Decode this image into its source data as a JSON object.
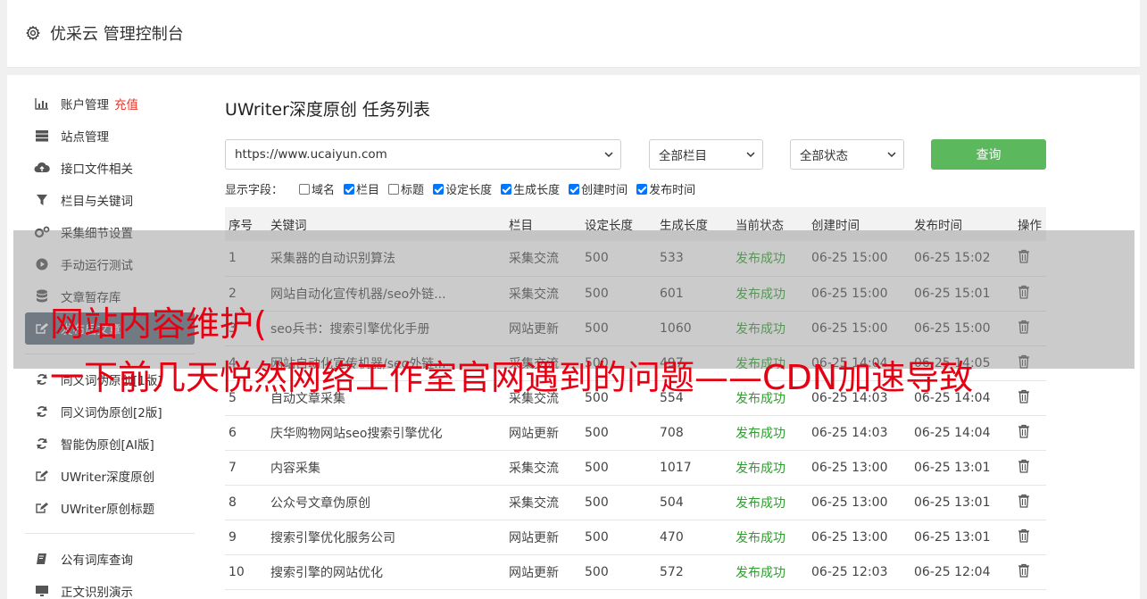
{
  "header": {
    "title": "优采云 管理控制台"
  },
  "sidebar": {
    "items": [
      {
        "label": "账户管理",
        "extra": "充值",
        "icon": "bar-chart-icon"
      },
      {
        "label": "站点管理",
        "icon": "server-icon"
      },
      {
        "label": "接口文件相关",
        "icon": "cloud-upload-icon"
      },
      {
        "label": "栏目与关键词",
        "icon": "filter-icon"
      },
      {
        "label": "采集细节设置",
        "icon": "gears-icon"
      },
      {
        "label": "手动运行测试",
        "icon": "play-circle-icon"
      },
      {
        "label": "文章暂存库",
        "icon": "database-icon"
      },
      {
        "label": "发布后文章",
        "icon": "edit-icon"
      },
      {
        "label": "同义词伪原创[1版]",
        "icon": "refresh-icon"
      },
      {
        "label": "同义词伪原创[2版]",
        "icon": "refresh-icon"
      },
      {
        "label": "智能伪原创[AI版]",
        "icon": "refresh-icon"
      },
      {
        "label": "UWriter深度原创",
        "icon": "edit-icon"
      },
      {
        "label": "UWriter原创标题",
        "icon": "edit-icon"
      },
      {
        "label": "公有词库查询",
        "icon": "book-icon"
      },
      {
        "label": "正文识别演示",
        "icon": "monitor-icon"
      }
    ]
  },
  "main": {
    "title": "UWriter深度原创 任务列表",
    "site_select": "https://www.ucaiyun.com",
    "column_select": "全部栏目",
    "status_select": "全部状态",
    "query_label": "查询",
    "fields_label": "显示字段：",
    "fields": [
      {
        "label": "域名",
        "checked": false
      },
      {
        "label": "栏目",
        "checked": true
      },
      {
        "label": "标题",
        "checked": false
      },
      {
        "label": "设定长度",
        "checked": true
      },
      {
        "label": "生成长度",
        "checked": true
      },
      {
        "label": "创建时间",
        "checked": true
      },
      {
        "label": "发布时间",
        "checked": true
      }
    ],
    "columns": [
      "序号",
      "关键词",
      "栏目",
      "设定长度",
      "生成长度",
      "当前状态",
      "创建时间",
      "发布时间",
      "操作"
    ],
    "rows": [
      [
        "1",
        "采集器的自动识别算法",
        "采集交流",
        "500",
        "533",
        "发布成功",
        "06-25 15:00",
        "06-25 15:02"
      ],
      [
        "2",
        "网站自动化宣传机器/seo外链...",
        "采集交流",
        "500",
        "601",
        "发布成功",
        "06-25 15:00",
        "06-25 15:01"
      ],
      [
        "3",
        "seo兵书：搜索引擎优化手册",
        "网站更新",
        "500",
        "1060",
        "发布成功",
        "06-25 15:00",
        "06-25 15:00"
      ],
      [
        "4",
        "网站自动化宣传机器/seo外链...",
        "采集交流",
        "500",
        "497",
        "发布成功",
        "06-25 14:04",
        "06-25 14:05"
      ],
      [
        "5",
        "自动文章采集",
        "采集交流",
        "500",
        "554",
        "发布成功",
        "06-25 14:03",
        "06-25 14:04"
      ],
      [
        "6",
        "庆华购物网站seo搜索引擎优化",
        "网站更新",
        "500",
        "708",
        "发布成功",
        "06-25 14:03",
        "06-25 14:04"
      ],
      [
        "7",
        "内容采集",
        "采集交流",
        "500",
        "1017",
        "发布成功",
        "06-25 13:00",
        "06-25 13:01"
      ],
      [
        "8",
        "公众号文章伪原创",
        "采集交流",
        "500",
        "504",
        "发布成功",
        "06-25 13:00",
        "06-25 13:01"
      ],
      [
        "9",
        "搜索引擎优化服务公司",
        "网站更新",
        "500",
        "470",
        "发布成功",
        "06-25 13:00",
        "06-25 13:01"
      ],
      [
        "10",
        "搜索引擎的网站优化",
        "网站更新",
        "500",
        "572",
        "发布成功",
        "06-25 12:03",
        "06-25 12:04"
      ]
    ]
  },
  "overlay": {
    "line1": "网站内容维护(",
    "line2": "一下前几天悦然网络工作室官网遇到的问题——CDN加速导致"
  },
  "colors": {
    "accent_green": "#5cb85c",
    "status_green": "#2e9e2e",
    "overlay_red": "#e60012",
    "active_bg": "#5b6b7c"
  }
}
